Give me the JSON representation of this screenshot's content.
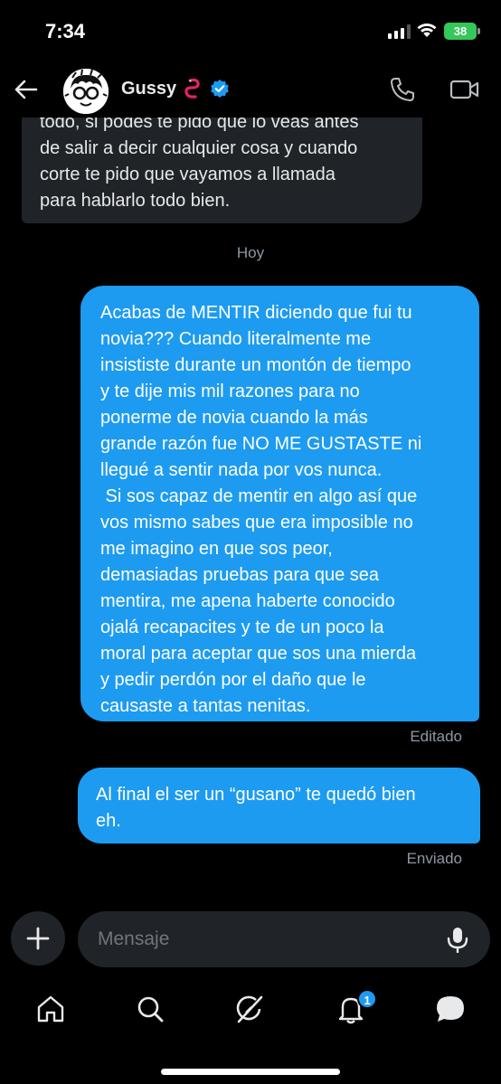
{
  "status_bar": {
    "time": "7:34",
    "battery": "38"
  },
  "header": {
    "contact_name": "Gussy",
    "icons": [
      "back-arrow-icon",
      "worm-emoji",
      "verified-icon",
      "phone-icon",
      "video-icon"
    ]
  },
  "conversation": {
    "incoming": [
      {
        "lines": [
          "todo, si podes te pido que lo veas antes",
          "de salir a decir cualquier cosa y cuando",
          "corte te pido que vayamos a llamada",
          "para hablarlo todo bien."
        ]
      }
    ],
    "date_divider": "Hoy",
    "outgoing": [
      {
        "lines": [
          "Acabas de MENTIR diciendo que fui tu",
          "novia??? Cuando literalmente me",
          "insististe durante un montón de tiempo",
          "y te dije mis mil razones para no",
          "ponerme de novia cuando la más",
          "grande razón fue NO ME GUSTASTE ni",
          "llegué a sentir nada por vos nunca.",
          " Si sos capaz de mentir en algo así que",
          "vos mismo sabes que era imposible no",
          "me imagino en que sos peor,",
          "demasiadas pruebas para que sea",
          "mentira, me apena haberte conocido",
          "ojalá recapacites y te de un poco la",
          "moral para aceptar que sos una mierda",
          "y pedir perdón por el daño que le",
          "causaste a tantas nenitas."
        ],
        "status": "Editado"
      },
      {
        "lines": [
          "Al final el ser un “gusano” te quedó bien",
          "eh."
        ],
        "status": "Enviado"
      }
    ]
  },
  "compose": {
    "placeholder": "Mensaje",
    "value": ""
  },
  "tabbar": {
    "tabs": [
      "home-icon",
      "search-icon",
      "grok-icon",
      "notifications-icon",
      "messages-icon"
    ],
    "notifications_badge": "1"
  },
  "colors": {
    "accent": "#1d9bf0",
    "incoming_bubble": "#202327",
    "muted": "#8b98a5",
    "battery": "#34c759"
  }
}
